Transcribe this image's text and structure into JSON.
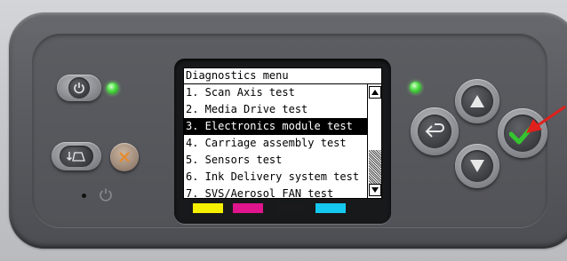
{
  "lcd": {
    "title": "Diagnostics menu",
    "items": [
      {
        "label": "1. Scan Axis test"
      },
      {
        "label": "2. Media Drive test"
      },
      {
        "label": "3. Electronics module test"
      },
      {
        "label": "4. Carriage assembly test"
      },
      {
        "label": "5. Sensors test"
      },
      {
        "label": "6. Ink Delivery system test"
      },
      {
        "label": "7. SVS/Aerosol FAN test"
      }
    ],
    "selected_index": 2
  },
  "icons": {
    "power": "power-icon",
    "form_feed": "form-feed-icon",
    "cancel": "cancel-x-icon",
    "back": "back-arrow-icon",
    "up": "up-arrow-icon",
    "down": "down-arrow-icon",
    "ok": "checkmark-icon"
  },
  "ink_colors": [
    "#f5f000",
    "#e0148c",
    "#1a1a1a",
    "#14c8f0"
  ],
  "led_color": "#54e04a",
  "callout_color": "#e0201c"
}
